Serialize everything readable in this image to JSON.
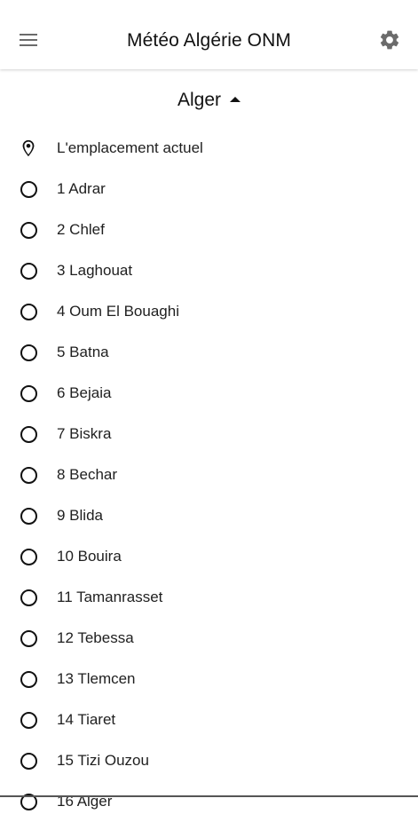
{
  "app_bar": {
    "title": "Météo Algérie ONM",
    "menu_icon": "menu-icon",
    "settings_icon": "gear-icon"
  },
  "city_selector": {
    "selected": "Alger",
    "expanded_icon": "caret-up-icon"
  },
  "current_location": {
    "label": "L'emplacement actuel",
    "icon": "location-pin-icon"
  },
  "wilayas": [
    {
      "label": "1 Adrar"
    },
    {
      "label": "2 Chlef"
    },
    {
      "label": "3 Laghouat"
    },
    {
      "label": "4 Oum El Bouaghi"
    },
    {
      "label": "5 Batna"
    },
    {
      "label": "6 Bejaia"
    },
    {
      "label": "7 Biskra"
    },
    {
      "label": "8 Bechar"
    },
    {
      "label": "9 Blida"
    },
    {
      "label": "10 Bouira"
    },
    {
      "label": "11 Tamanrasset"
    },
    {
      "label": "12 Tebessa"
    },
    {
      "label": "13 Tlemcen"
    },
    {
      "label": "14 Tiaret"
    },
    {
      "label": "15 Tizi Ouzou"
    },
    {
      "label": "16 Alger"
    }
  ],
  "colors": {
    "text": "#1f1f1f",
    "icon": "#111111",
    "settings_icon": "#6b6b6b",
    "background": "#ffffff"
  }
}
